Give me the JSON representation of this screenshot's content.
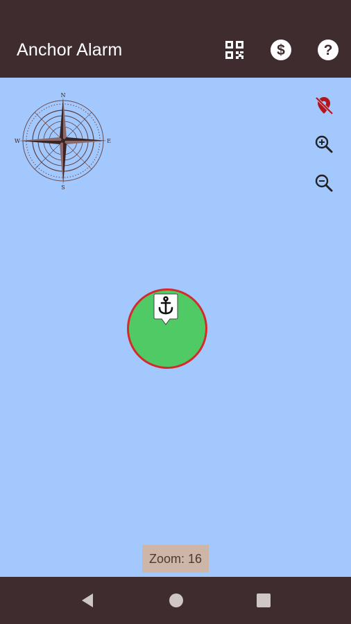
{
  "app": {
    "title": "Anchor Alarm"
  },
  "appbar": {
    "actions": [
      {
        "name": "qr-code-icon"
      },
      {
        "name": "dollar-icon"
      },
      {
        "name": "help-icon"
      }
    ]
  },
  "map": {
    "zoom_label": "Zoom: 16",
    "controls": [
      "location-off-icon",
      "zoom-in-icon",
      "zoom-out-icon"
    ],
    "compass": {
      "n": "N",
      "s": "S",
      "e": "E",
      "w": "W"
    }
  },
  "colors": {
    "primary": "#3f2c2f",
    "map_water": "#a3c8fe",
    "radius_fill": "#4fca64",
    "radius_border": "#d62a2a",
    "location_off": "#b1161d",
    "zoom_label_bg": "#cdb6a8"
  },
  "navbar": {
    "buttons": [
      "back-icon",
      "home-icon",
      "recents-icon"
    ]
  }
}
